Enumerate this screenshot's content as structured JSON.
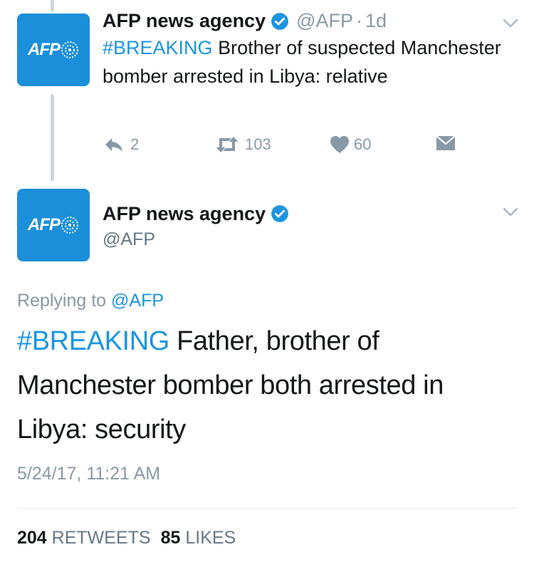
{
  "thread": {
    "tweet1": {
      "author_name": "AFP news agency",
      "handle": "@AFP",
      "separator": "·",
      "time": "1d",
      "hashtag": "#BREAKING",
      "text": " Brother of suspected Manchester bomber arrested in Libya: relative",
      "reply_count": "2",
      "retweet_count": "103",
      "like_count": "60"
    },
    "tweet2": {
      "author_name": "AFP news agency",
      "handle": "@AFP",
      "replying_prefix": "Replying to ",
      "replying_handle": "@AFP",
      "hashtag": "#BREAKING",
      "text": " Father, brother of Manchester bomber both arrested in Libya: security",
      "timestamp": "5/24/17, 11:21 AM",
      "retweets_count": "204",
      "retweets_label": "RETWEETS",
      "likes_count": "85",
      "likes_label": "LIKES"
    }
  },
  "avatar": {
    "logo_text": "AFP"
  },
  "colors": {
    "brand_blue": "#1b8fd9",
    "link_blue": "#1b95e0",
    "muted_gray": "#8899a6",
    "text_dark": "#14171a"
  },
  "icons": [
    "verified-badge-icon",
    "chevron-down-icon",
    "reply-icon",
    "retweet-icon",
    "like-heart-icon",
    "direct-message-icon"
  ]
}
